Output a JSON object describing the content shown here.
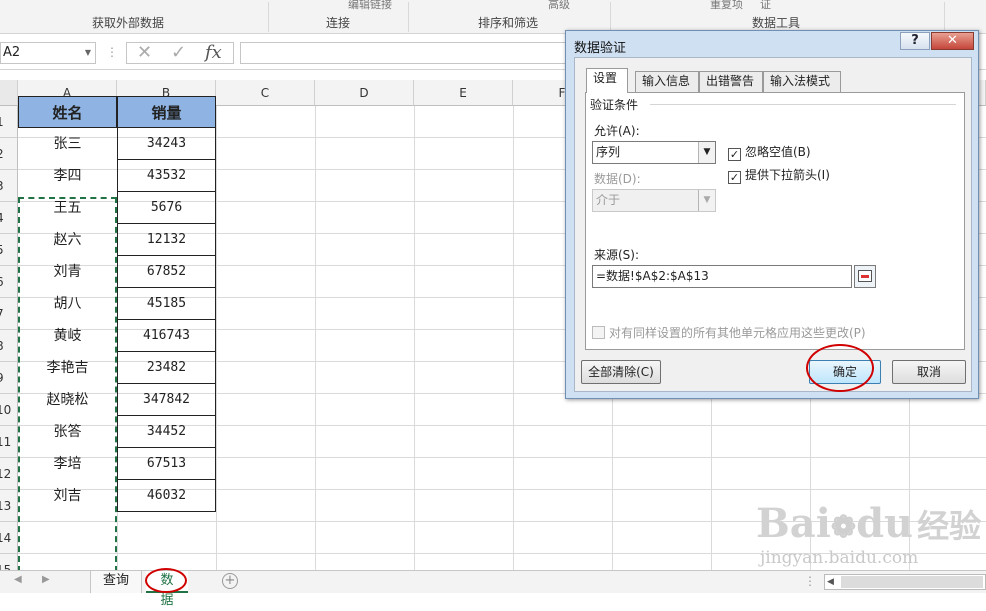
{
  "ribbon": {
    "groups": [
      "获取外部数据",
      "连接",
      "排序和筛选",
      "数据工具"
    ],
    "top_items": [
      "编辑链接",
      "高级",
      "重复项",
      "证"
    ]
  },
  "formula_bar": {
    "name_box": "A2",
    "fx_label": "fx",
    "formula": ""
  },
  "columns": [
    "A",
    "B",
    "C",
    "D",
    "E",
    "F"
  ],
  "rows": [
    "1",
    "2",
    "3",
    "4",
    "5",
    "6",
    "7",
    "8",
    "9",
    "10",
    "11",
    "12",
    "13",
    "14",
    "15"
  ],
  "table": {
    "header": [
      "姓名",
      "销量"
    ],
    "data": [
      [
        "张三",
        "34243"
      ],
      [
        "李四",
        "43532"
      ],
      [
        "王五",
        "5676"
      ],
      [
        "赵六",
        "12132"
      ],
      [
        "刘青",
        "67852"
      ],
      [
        "胡八",
        "45185"
      ],
      [
        "黄岐",
        "416743"
      ],
      [
        "李艳吉",
        "23482"
      ],
      [
        "赵晓松",
        "347842"
      ],
      [
        "张答",
        "34452"
      ],
      [
        "李培",
        "67513"
      ],
      [
        "刘吉",
        "46032"
      ]
    ]
  },
  "sheet_tabs": [
    "查询",
    "数据"
  ],
  "dialog": {
    "title": "数据验证",
    "help": "?",
    "tabs": [
      "设置",
      "输入信息",
      "出错警告",
      "输入法模式"
    ],
    "group_label": "验证条件",
    "allow_label": "允许(A):",
    "allow_value": "序列",
    "data_label": "数据(D):",
    "data_value": "介于",
    "ignore_blank": "忽略空值(B)",
    "dropdown_arrow": "提供下拉箭头(I)",
    "source_label": "来源(S):",
    "source_value": "=数据!$A$2:$A$13",
    "apply_all": "对有同样设置的所有其他单元格应用这些更改(P)",
    "clear_all": "全部清除(C)",
    "ok": "确定",
    "cancel": "取消"
  },
  "watermark": {
    "brand": "Bai",
    "brand2": "du",
    "cn": "经验",
    "url": "jingyan.baidu.com"
  },
  "colors": {
    "header_fill": "#8fb4e3",
    "selection": "#217346",
    "annotation": "#d10000"
  }
}
